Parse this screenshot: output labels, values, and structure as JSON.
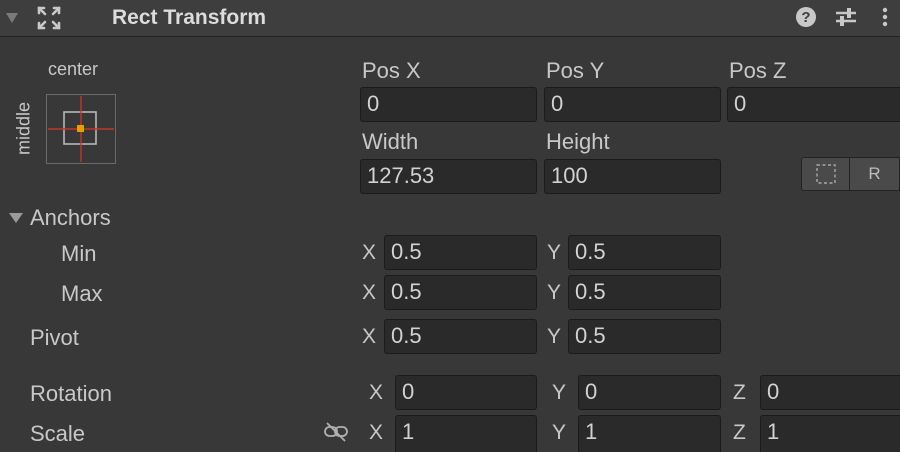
{
  "header": {
    "title": "Rect Transform"
  },
  "anchor_preset": {
    "horizontal": "center",
    "vertical": "middle"
  },
  "position": {
    "pos_x_label": "Pos X",
    "pos_x": "0",
    "pos_y_label": "Pos Y",
    "pos_y": "0",
    "pos_z_label": "Pos Z",
    "pos_z": "0"
  },
  "size": {
    "width_label": "Width",
    "width": "127.53",
    "height_label": "Height",
    "height": "100"
  },
  "buttons": {
    "raw_edit": "R"
  },
  "anchors": {
    "label": "Anchors",
    "min_label": "Min",
    "min_x": "0.5",
    "min_y": "0.5",
    "max_label": "Max",
    "max_x": "0.5",
    "max_y": "0.5"
  },
  "pivot": {
    "label": "Pivot",
    "x": "0.5",
    "y": "0.5"
  },
  "rotation": {
    "label": "Rotation",
    "x": "0",
    "y": "0",
    "z": "0"
  },
  "scale": {
    "label": "Scale",
    "x": "1",
    "y": "1",
    "z": "1"
  },
  "axis_labels": {
    "x": "X",
    "y": "Y",
    "z": "Z"
  },
  "colors": {
    "background": "#383838",
    "field": "#2a2a2a",
    "anchor_red": "#c0392b",
    "pivot_orange": "#e8a000"
  }
}
